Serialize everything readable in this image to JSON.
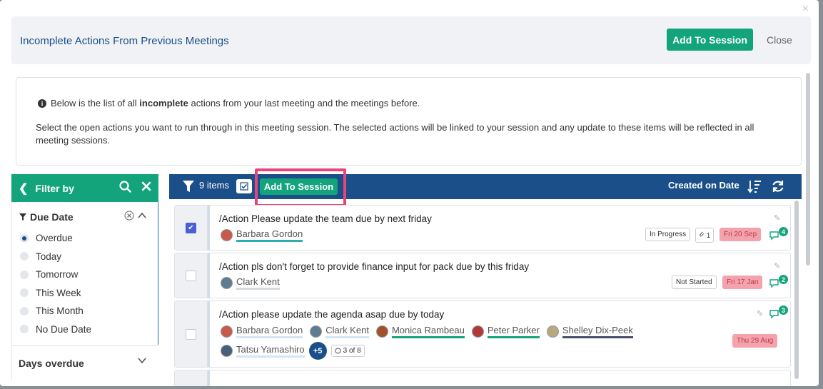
{
  "modal": {
    "title": "Incomplete Actions From Previous Meetings",
    "add_label": "Add To Session",
    "close_label": "Close",
    "close_x": "×"
  },
  "info": {
    "line1_pre": "Below is the list of all ",
    "line1_bold": "incomplete",
    "line1_post": " actions from your last meeting and the meetings before.",
    "line2": "Select the open actions you want to run through in this meeting session. The selected actions will be linked to your session and any update to these items will be reflected in all meeting sessions."
  },
  "filter": {
    "title": "Filter by",
    "due_date_label": "Due Date",
    "options": [
      "Overdue",
      "Today",
      "Tomorrow",
      "This Week",
      "This Month",
      "No Due Date"
    ],
    "selected": "Overdue",
    "days_overdue_label": "Days overdue"
  },
  "toolbar": {
    "count": "9 items",
    "add_label": "Add To Session",
    "sort_label": "Created on Date"
  },
  "rows": [
    {
      "title": "/Action Please update the team due by next friday",
      "checked": true,
      "people": [
        {
          "name": "Barbara Gordon",
          "line": "teal"
        }
      ],
      "status": "In Progress",
      "attachments": "1",
      "date": "Fri 20 Sep",
      "comments": "4"
    },
    {
      "title": "/Action pls don't forget to provide finance input for pack due by this friday",
      "checked": false,
      "people": [
        {
          "name": "Clark Kent",
          "line": "grey"
        }
      ],
      "status": "Not Started",
      "date": "Fri 17 Jan",
      "comments": "2"
    },
    {
      "title": "/Action please update the agenda asap due by today",
      "checked": false,
      "people": [
        {
          "name": "Barbara Gordon",
          "line": "light"
        },
        {
          "name": "Clark Kent",
          "line": "light"
        },
        {
          "name": "Monica Rambeau",
          "line": "green"
        },
        {
          "name": "Peter Parker",
          "line": "green"
        },
        {
          "name": "Shelley Dix-Peek",
          "line": "dark"
        },
        {
          "name": "Tatsu Yamashiro",
          "line": "light"
        }
      ],
      "more": "+5",
      "progress": "3 of 8",
      "date": "Thu 29 Aug",
      "comments": "3"
    }
  ],
  "colors": {
    "accent_green": "#13a47c",
    "navy": "#1b4f8a",
    "highlight": "#e8457a",
    "date_pink": "#f4a3ad"
  },
  "icons": {
    "filter": "funnel-icon",
    "search": "search-icon",
    "clear": "close-icon",
    "sort": "sort-descending-icon",
    "refresh": "refresh-icon",
    "chat": "comment-icon",
    "edit": "pencil-icon",
    "attach": "paperclip-icon"
  }
}
